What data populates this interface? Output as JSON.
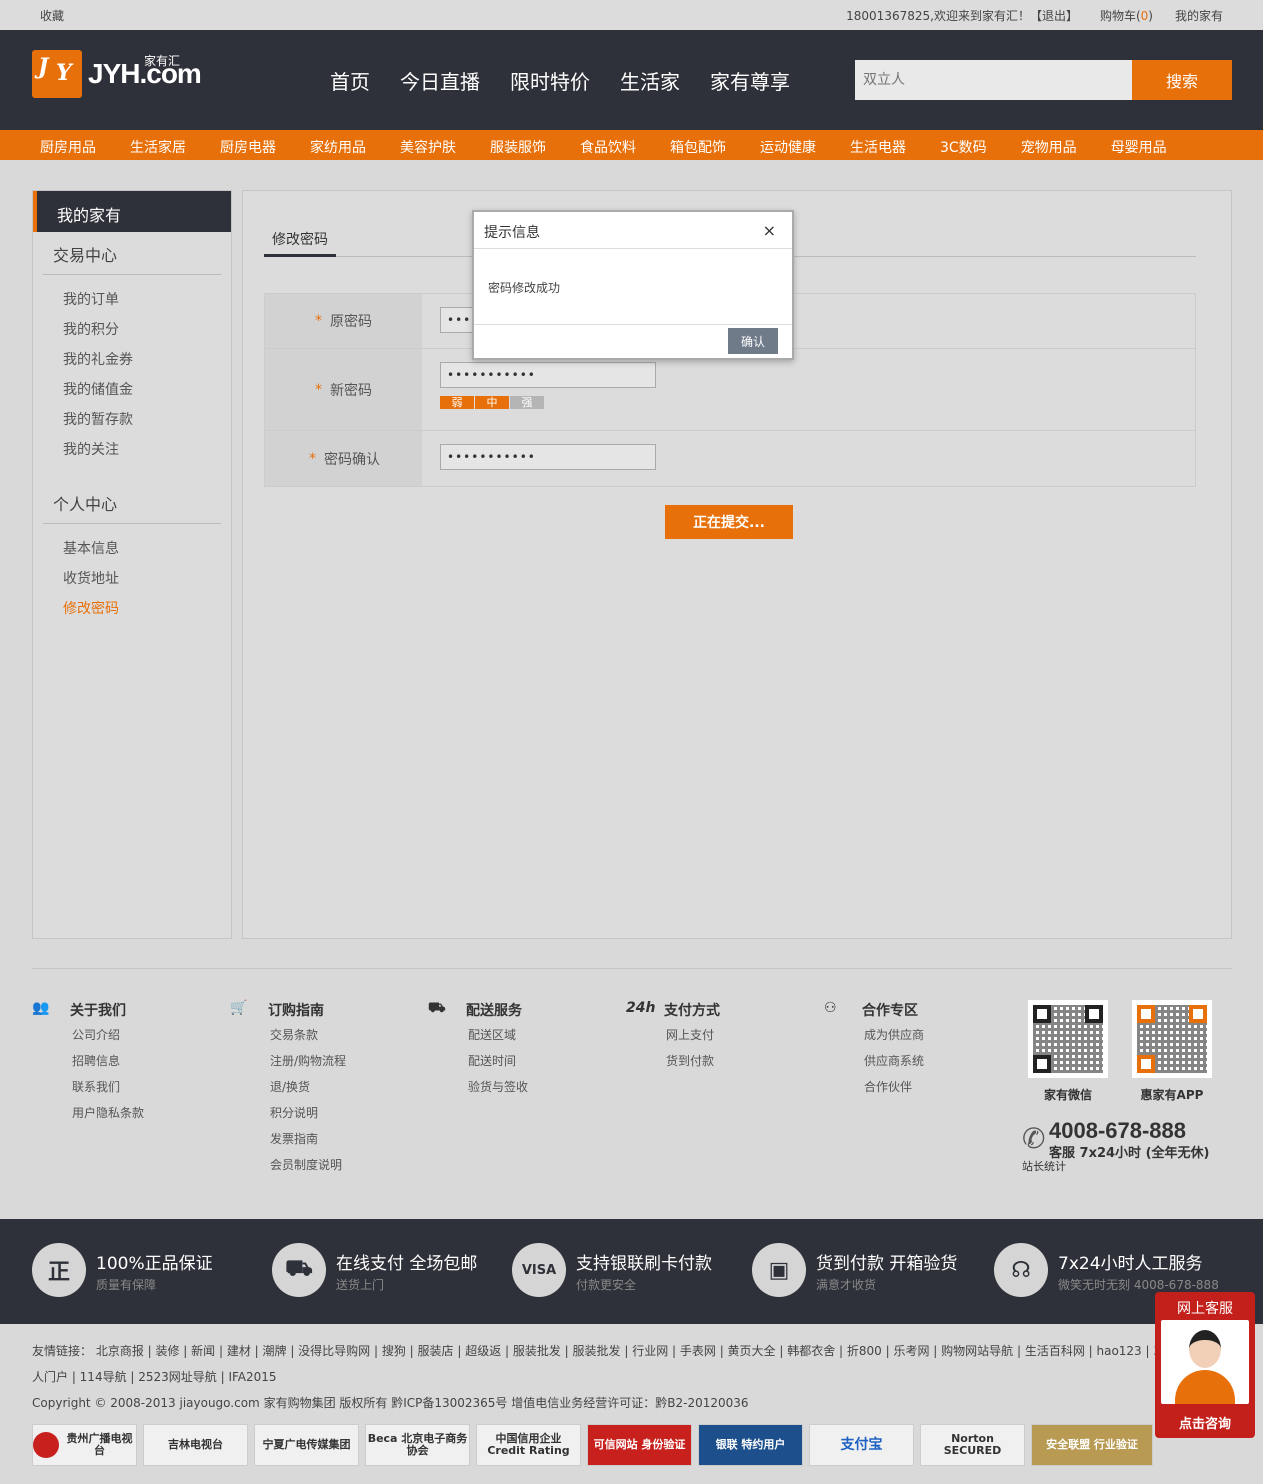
{
  "topbar": {
    "fav": "收藏",
    "welcome": "18001367825,欢迎来到家有汇！",
    "logout": "【退出】",
    "cart_label": "购物车(",
    "cart_count": "0",
    "cart_close": ")",
    "my_home": "我的家有"
  },
  "header": {
    "logo_text": "JYH.com",
    "logo_sub": "家有汇",
    "nav": [
      "首页",
      "今日直播",
      "限时特价",
      "生活家",
      "家有尊享"
    ],
    "search_placeholder": "双立人",
    "search_button": "搜索"
  },
  "categories": [
    "厨房用品",
    "生活家居",
    "厨房电器",
    "家纺用品",
    "美容护肤",
    "服装服饰",
    "食品饮料",
    "箱包配饰",
    "运动健康",
    "生活电器",
    "3C数码",
    "宠物用品",
    "母婴用品"
  ],
  "sidebar": {
    "title": "我的家有",
    "group1": "交易中心",
    "group1_items": [
      "我的订单",
      "我的积分",
      "我的礼金券",
      "我的储值金",
      "我的暂存款",
      "我的关注"
    ],
    "group2": "个人中心",
    "group2_items": [
      "基本信息",
      "收货地址",
      "修改密码"
    ]
  },
  "form": {
    "tab": "修改密码",
    "old_label": "原密码",
    "new_label": "新密码",
    "confirm_label": "密码确认",
    "star": "*",
    "old_value": "•••••••••••",
    "new_value": "•••••••••••",
    "confirm_value": "•••••••••••",
    "strength": [
      "弱",
      "中",
      "强"
    ],
    "submit": "正在提交..."
  },
  "dialog": {
    "title": "提示信息",
    "close": "×",
    "message": "密码修改成功",
    "ok": "确认"
  },
  "footer": {
    "cols": [
      {
        "title": "关于我们",
        "icon": "people-icon",
        "items": [
          "公司介绍",
          "招聘信息",
          "联系我们",
          "用户隐私条款"
        ]
      },
      {
        "title": "订购指南",
        "icon": "cart-icon",
        "items": [
          "交易条款",
          "注册/购物流程",
          "退/换货",
          "积分说明",
          "发票指南",
          "会员制度说明"
        ]
      },
      {
        "title": "配送服务",
        "icon": "truck-icon",
        "items": [
          "配送区域",
          "配送时间",
          "验货与签收"
        ]
      },
      {
        "title": "支付方式",
        "icon": "24h-icon",
        "items": [
          "网上支付",
          "货到付款"
        ]
      },
      {
        "title": "合作专区",
        "icon": "partner-icon",
        "items": [
          "成为供应商",
          "供应商系统",
          "合作伙伴"
        ]
      }
    ],
    "qr1": "家有微信",
    "qr2": "惠家有APP",
    "phone": "4008-678-888",
    "phone_sub": "客服 7x24小时 (全年无休)",
    "stat": "站长统计"
  },
  "service": [
    {
      "icon": "正",
      "title": "100%正品保证",
      "sub": "质量有保障"
    },
    {
      "icon": "⛟",
      "title": "在线支付 全场包邮",
      "sub": "送货上门"
    },
    {
      "icon": "VISA",
      "title": "支持银联刷卡付款",
      "sub": "付款更安全"
    },
    {
      "icon": "▣",
      "title": "货到付款 开箱验货",
      "sub": "满意才收货"
    },
    {
      "icon": "☊",
      "title": "7x24小时人工服务",
      "sub": "微笑无时无刻 4008-678-888"
    }
  ],
  "links": {
    "line1": "友情链接： 北京商报 | 装修 | 新闻 | 建材 | 潮牌 | 没得比导购网 | 搜狗 | 服装店 | 超级返 | 服装批发 | 服装批发 | 行业网 | 手表网 | 黄页大全 | 韩都衣舍 | 折800 | 乐考网 | 购物网站导航 | 生活百科网 | hao123 | 360",
    "line2": "人门户 | 114导航 | 2523网址导航 | IFA2015",
    "copyright": "Copyright © 2008-2013 jiayougo.com 家有购物集团 版权所有 黔ICP备13002365号 增值电信业务经营许可证：黔B2-20120036"
  },
  "badges": [
    "贵州广播电视台",
    "吉林电视台",
    "宁夏广电传媒集团",
    "Beca 北京电子商务协会",
    "中国信用企业 Credit Rating",
    "可信网站 身份验证",
    "银联 特约用户",
    "支付宝",
    "Norton SECURED",
    "安全联盟 行业验证"
  ],
  "kefu": {
    "title": "网上客服",
    "button": "点击咨询"
  },
  "colors": {
    "accent": "#e8700a",
    "dark": "#2e3139"
  }
}
